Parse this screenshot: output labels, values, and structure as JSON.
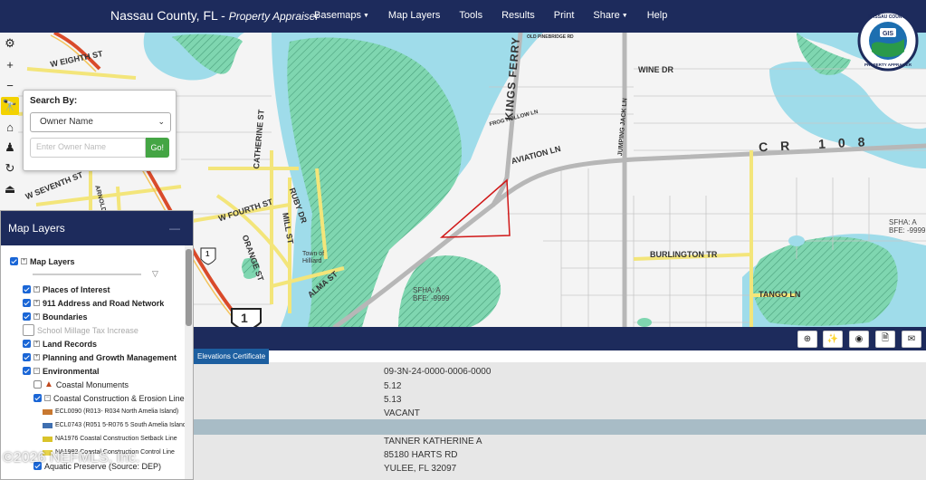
{
  "app": {
    "title": "Nassau County, FL",
    "separator": " - ",
    "subtitle": "Property Appraiser",
    "logo_text": "NASSAU COUNTY GIS PROPERTY APPRAISER"
  },
  "menu": {
    "basemaps": "Basemaps",
    "map_layers": "Map Layers",
    "tools": "Tools",
    "results": "Results",
    "print": "Print",
    "share": "Share",
    "help": "Help"
  },
  "map_tools": [
    "gear-icon",
    "zoom-in-icon",
    "zoom-out-icon",
    "binoculars-icon",
    "home-icon",
    "person-icon",
    "pan-icon",
    "measure-icon"
  ],
  "map_tool_glyphs": [
    "⚙",
    "+",
    "−",
    "🔭",
    "⌂",
    "♟",
    "↻",
    "⏏"
  ],
  "search": {
    "title": "Search By:",
    "selected": "Owner Name",
    "placeholder": "Enter Owner Name",
    "go": "Go!"
  },
  "streets": {
    "w_eighth": "W EIGHTH ST",
    "w_seventh": "W SEVENTH ST",
    "w_fourth": "W FOURTH ST",
    "catherine": "CATHERINE ST",
    "ruby": "RUBY DR",
    "mill": "MILL ST",
    "orange": "ORANGE ST",
    "alma": "ALMA ST",
    "kings_ferry": "KINGS FERRY RD",
    "wine": "WINE DR",
    "frog_hollow": "FROG HOLLOW LN",
    "aviation": "AVIATION LN",
    "jumping_jack": "JUMPING JACK LN",
    "burlington": "BURLINGTON TR",
    "tango": "TANGO LN",
    "cr": "CR 108",
    "old_pinebridge": "OLD PINEBRIDGE RD",
    "town": "Town of Hilliard",
    "arnold": "ARNOLD RD",
    "route1": "1"
  },
  "flood": {
    "a_left": "SFHA: A\nBFE: -9999",
    "a_right": "SFHA: A\nBFE: -9999"
  },
  "layers": {
    "header": "Map Layers",
    "root": "Map Layers",
    "items": [
      {
        "label": "Places of Interest",
        "checked": true
      },
      {
        "label": "911 Address and Road Network",
        "checked": true
      },
      {
        "label": "Boundaries",
        "checked": true
      },
      {
        "label": "School Millage Tax Increase",
        "checked": false
      },
      {
        "label": "Land Records",
        "checked": true
      },
      {
        "label": "Planning and Growth Management",
        "checked": true
      },
      {
        "label": "Environmental",
        "checked": true
      }
    ],
    "sub": {
      "coastal_monuments": "Coastal Monuments",
      "ccel": "Coastal Construction & Erosion Lines",
      "ecl0090": "ECL0090 (R013- R034 North Amelia Island)",
      "ecl0743": "ECL0743 (R051 5-R076 5 South Amelia Island)",
      "na1976": "NA1976 Coastal Construction Setback Line",
      "na1982": "NA1982 Coastal Construction Control Line",
      "aquatic": "Aquatic Preserve (Source: DEP)"
    },
    "swatch_colors": [
      "#c87830",
      "#3f6fb0",
      "#d9c32a",
      "#e8d44a"
    ]
  },
  "result": {
    "tab": "Elevations Certificate",
    "tools": [
      "zoom-in-icon",
      "magic-wand-icon",
      "target-icon",
      "excel-export-icon",
      "email-icon"
    ],
    "tool_glyphs": [
      "⊕",
      "✨",
      "◉",
      "🗎",
      "✉"
    ],
    "parcel_id": "09-3N-24-0000-0006-0000",
    "value1": "5.12",
    "value2": "5.13",
    "land_use": "VACANT",
    "owner": "TANNER KATHERINE A",
    "address": "85180 HARTS RD",
    "city": "YULEE, FL 32097"
  },
  "watermark": "©2026 NEFMLS, Inc.",
  "colors": {
    "nav": "#1d2b5c",
    "water": "#9fdcea",
    "wetland": "#7fd6b0",
    "road_major": "#d94a2a",
    "road_yellow": "#f3e57a",
    "parcel_outline": "#d01818"
  }
}
